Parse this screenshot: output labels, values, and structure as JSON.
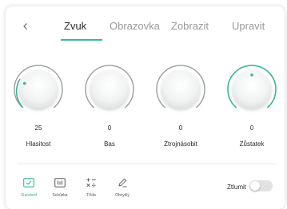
{
  "tabs": [
    {
      "label": "Zvuk",
      "active": true
    },
    {
      "label": "Obrazovka",
      "active": false
    },
    {
      "label": "Zobrazit",
      "active": false
    },
    {
      "label": "Upravit",
      "active": false
    }
  ],
  "knobs": [
    {
      "value": "25",
      "label": "Hlasitost"
    },
    {
      "value": "0",
      "label": "Bas"
    },
    {
      "value": "0",
      "label": "Ztrojnásobit"
    },
    {
      "value": "0",
      "label": "Zůstatek"
    }
  ],
  "presets": [
    {
      "label": "Standard",
      "icon": "check-box-icon",
      "active": true
    },
    {
      "label": "Schůzka",
      "icon": "equalizer-box-icon",
      "active": false
    },
    {
      "label": "Třída",
      "icon": "math-symbols-icon",
      "active": false
    },
    {
      "label": "Obvyklý",
      "icon": "pencil-icon",
      "active": false
    }
  ],
  "mute": {
    "label": "Ztlumit",
    "on": false
  },
  "colors": {
    "accent": "#38b89a",
    "text": "#2b2b2b",
    "muted": "#9a9a9a"
  }
}
